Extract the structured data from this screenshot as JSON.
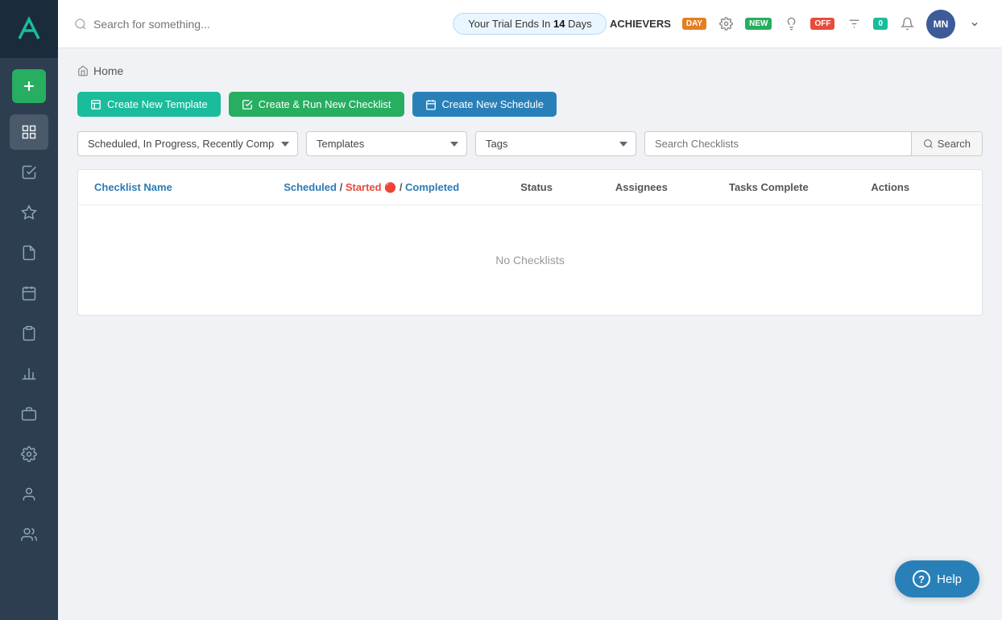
{
  "topbar": {
    "search_placeholder": "Search for something...",
    "trial_text": "Your Trial Ends In ",
    "trial_days": "14",
    "trial_suffix": " Days",
    "org_name": "ACHIEVERS",
    "badge_day": "DAY",
    "badge_new": "NEW",
    "badge_off": "OFF",
    "badge_notif": "0",
    "avatar_initials": "MN"
  },
  "breadcrumb": {
    "home_label": "Home"
  },
  "actions": {
    "create_template": "Create New Template",
    "create_run_checklist": "Create & Run New Checklist",
    "create_schedule": "Create New Schedule"
  },
  "filters": {
    "status_value": "Scheduled, In Progress, Recently Comp",
    "templates_placeholder": "Templates",
    "tags_placeholder": "Tags",
    "search_placeholder": "Search Checklists",
    "search_button": "Search"
  },
  "table": {
    "headers": {
      "checklist_name": "Checklist Name",
      "scheduled": "Scheduled",
      "slash1": " / ",
      "started": "Started",
      "fire_icon": "🔴",
      "slash2": " / ",
      "completed": "Completed",
      "status": "Status",
      "assignees": "Assignees",
      "tasks_complete": "Tasks Complete",
      "actions": "Actions"
    },
    "empty_message": "No Checklists"
  },
  "help": {
    "label": "Help"
  },
  "sidebar": {
    "items": [
      {
        "name": "dashboard",
        "icon": "grid"
      },
      {
        "name": "checklist",
        "icon": "check-square"
      },
      {
        "name": "starred",
        "icon": "star"
      },
      {
        "name": "document",
        "icon": "file"
      },
      {
        "name": "calendar",
        "icon": "calendar"
      },
      {
        "name": "clipboard",
        "icon": "clipboard"
      },
      {
        "name": "chart",
        "icon": "bar-chart"
      },
      {
        "name": "briefcase",
        "icon": "briefcase"
      },
      {
        "name": "settings",
        "icon": "wrench"
      },
      {
        "name": "user",
        "icon": "user"
      },
      {
        "name": "team",
        "icon": "users"
      }
    ]
  }
}
